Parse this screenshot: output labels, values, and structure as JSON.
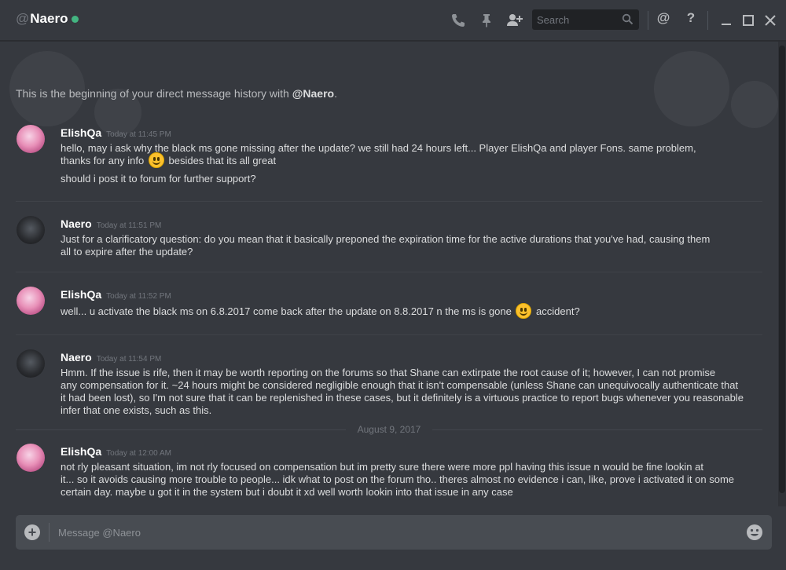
{
  "header": {
    "at_symbol": "@",
    "title": "Naero",
    "status_color": "#43b581",
    "icons": [
      "phone-icon",
      "pin-icon",
      "add-user-icon",
      "search-icon",
      "mention-icon",
      "help-icon",
      "minimize-icon",
      "maximize-icon",
      "close-icon"
    ],
    "search_placeholder": "Search",
    "mention_label": "@",
    "help_label": "?"
  },
  "intro": {
    "prefix": "This is the beginning of your direct message history with ",
    "handle": "@Naero",
    "suffix": "."
  },
  "messages": [
    {
      "author": "ElishQa",
      "time": "Today at 11:45 PM",
      "lines": [
        "hello, may i ask why the black ms gone missing after the update? we still had 24 hours left... Player ElishQa and player Fons. same problem,",
        "thanks for any info",
        "besides that its all great",
        "should i post it to forum for further support?"
      ]
    },
    {
      "author": "Naero",
      "time": "Today at 11:51 PM",
      "lines": [
        "Just for a clarificatory question: do you mean that it basically preponed the expiration time for the active durations that you've had, causing them",
        "all to expire after the update?"
      ]
    },
    {
      "author": "ElishQa",
      "time": "Today at 11:52 PM",
      "lines": [
        "well... u activate the black ms on 6.8.2017 come back after the update on 8.8.2017 n the ms is gone",
        "accident?"
      ]
    },
    {
      "author": "Naero",
      "time": "Today at 11:54 PM",
      "lines": [
        "Hmm. If the issue is rife, then it may be worth reporting on the forums so that Shane can extirpate the root cause of it; however, I can not promise",
        "any compensation for it. ~24 hours might be considered negligible enough that it isn't compensable (unless Shane can unequivocally authenticate that",
        "it had been lost), so I'm not sure that it can be replenished in these cases, but it definitely is a virtuous practice to report bugs whenever you reasonable",
        "infer that one exists, such as this."
      ]
    },
    {
      "author": "ElishQa",
      "time": "Today at 12:00 AM",
      "lines": [
        "not rly pleasant situation, im not rly focused on compensation but im pretty sure there were more ppl having this issue n would be fine lookin at",
        "it... so it avoids causing more trouble to people... idk what to post on the forum tho.. theres almost no evidence i can, like, prove i activated it on some",
        "certain day. maybe u got it in the system but i doubt it xd well worth lookin into that issue in any case"
      ]
    }
  ],
  "date_divider": "August 9, 2017",
  "composer": {
    "placeholder": "Message @Naero",
    "icons": [
      "add-attachment-icon",
      "emoji-picker-icon"
    ]
  },
  "colors": {
    "background": "#36393f",
    "online": "#43b581",
    "composer": "#484c52"
  }
}
